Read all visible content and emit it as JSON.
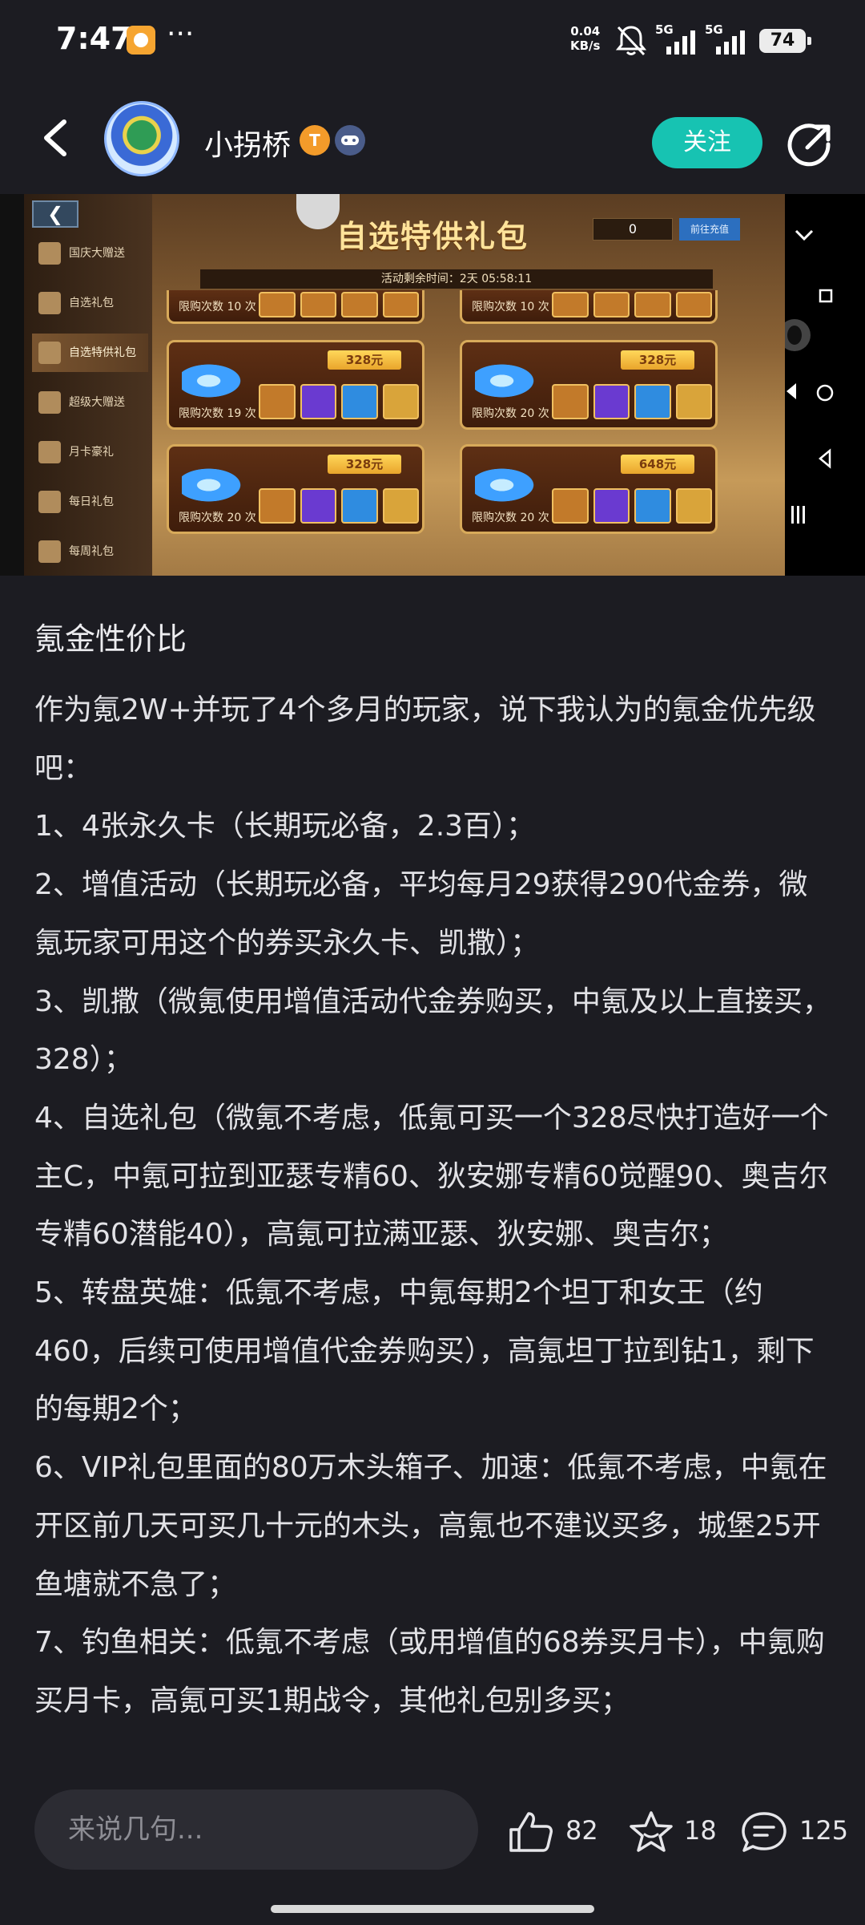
{
  "status_bar": {
    "time": "7:47",
    "more": "···",
    "net_speed_value": "0.04",
    "net_speed_unit": "KB/s",
    "signal_1_label": "5G",
    "signal_2_label": "5G",
    "battery": "74"
  },
  "header": {
    "username": "小拐桥",
    "follow_label": "关注"
  },
  "media": {
    "game_title": "自选特供礼包",
    "timer_text": "活动剩余时间：2天 05:58:11",
    "counter": "0",
    "go_label": "前往充值",
    "sidebar_back": "❮",
    "sidebar_items": [
      "国庆大赠送",
      "自选礼包",
      "自选特供礼包",
      "超级大赠送",
      "月卡豪礼",
      "每日礼包",
      "每周礼包"
    ],
    "cards": [
      {
        "limit": "限购次数 10 次"
      },
      {
        "limit": "限购次数 10 次"
      },
      {
        "price": "328元",
        "limit": "限购次数 19 次"
      },
      {
        "price": "328元",
        "limit": "限购次数 20 次"
      },
      {
        "price": "328元",
        "limit": "限购次数 20 次"
      },
      {
        "price": "648元",
        "limit": "限购次数 20 次"
      }
    ]
  },
  "post": {
    "title": "氪金性价比",
    "paragraphs": [
      "作为氪2W+并玩了4个多月的玩家，说下我认为的氪金优先级吧：",
      "1、4张永久卡（长期玩必备，2.3百）；",
      "2、增值活动（长期玩必备，平均每月29获得290代金券，微氪玩家可用这个的券买永久卡、凯撒）；",
      "3、凯撒（微氪使用增值活动代金券购买，中氪及以上直接买，328）；",
      "4、自选礼包（微氪不考虑，低氪可买一个328尽快打造好一个主C，中氪可拉到亚瑟专精60、狄安娜专精60觉醒90、奥吉尔专精60潜能40），高氪可拉满亚瑟、狄安娜、奥吉尔；",
      "5、转盘英雄：低氪不考虑，中氪每期2个坦丁和女王（约460，后续可使用增值代金券购买），高氪坦丁拉到钻1，剩下的每期2个；",
      "6、VIP礼包里面的80万木头箱子、加速：低氪不考虑，中氪在开区前几天可买几十元的木头，高氪也不建议买多，城堡25开鱼塘就不急了；",
      "7、钓鱼相关：低氪不考虑（或用增值的68券买月卡），中氪购买月卡，高氪可买1期战令，其他礼包别多买；"
    ]
  },
  "bottom_bar": {
    "comment_placeholder": "来说几句...",
    "likes": "82",
    "favorites": "18",
    "comments": "125"
  },
  "colors": {
    "background": "#1c1c22",
    "accent": "#17c3b2",
    "input_bg": "#2c2c33"
  }
}
